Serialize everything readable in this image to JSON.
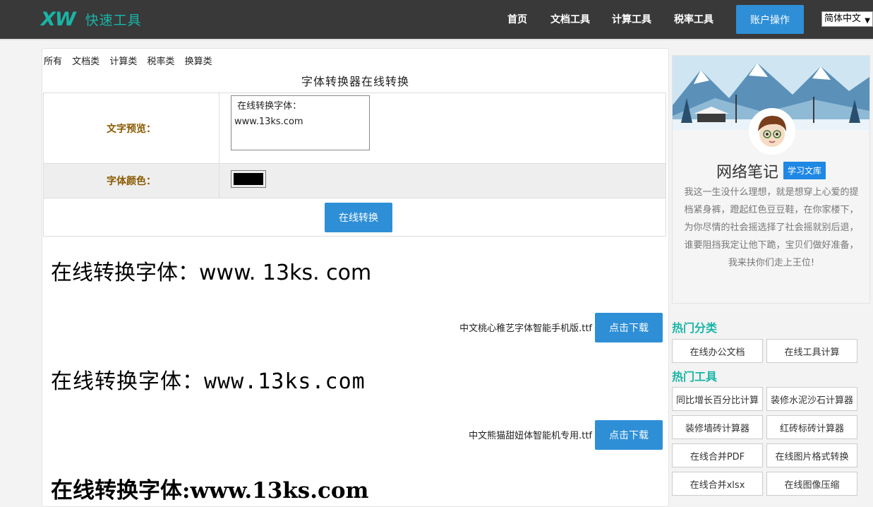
{
  "header": {
    "logo_mark": "XW",
    "logo_text": "快速工具",
    "nav": [
      "首页",
      "文档工具",
      "计算工具",
      "税率工具"
    ],
    "account_button": "账户操作",
    "language": "简体中文"
  },
  "categories": [
    "所有",
    "文档类",
    "计算类",
    "税率类",
    "换算类"
  ],
  "tool": {
    "title": "字体转换器在线转换",
    "preview_label": "文字预览：",
    "preview_value": " 在线转换字体：\nwww.13ks.com",
    "color_label": "字体颜色：",
    "color_value": "#000000",
    "convert_button": "在线转换"
  },
  "results": [
    {
      "sample": "在线转换字体：www. 13ks. com",
      "font_file": "中文桃心稚艺字体智能手机版.ttf",
      "download": "点击下载"
    },
    {
      "sample": "在线转换字体：www.13ks.com",
      "font_file": "中文熊猫甜妞体智能机专用.ttf",
      "download": "点击下载"
    },
    {
      "sample": "在线转换字体:www.13ks.com"
    }
  ],
  "profile": {
    "name": "网络笔记",
    "badge": "学习文库",
    "bio": "我这一生没什么理想，就是想穿上心爱的提档紧身裤，蹬起红色豆豆鞋，在你家楼下，为你尽情的社会摇选择了社会摇就别后退，谁要阻挡我定让他下跪，宝贝们做好准备，我来扶你们走上王位!"
  },
  "hot_categories": {
    "title": "热门分类",
    "items": [
      "在线办公文档",
      "在线工具计算"
    ]
  },
  "hot_tools": {
    "title": "热门工具",
    "items": [
      "同比增长百分比计算",
      "装修水泥沙石计算器",
      "装修墙砖计算器",
      "红砖标砖计算器",
      "在线合并PDF",
      "在线图片格式转换",
      "在线合并xlsx",
      "在线图像压缩"
    ]
  }
}
